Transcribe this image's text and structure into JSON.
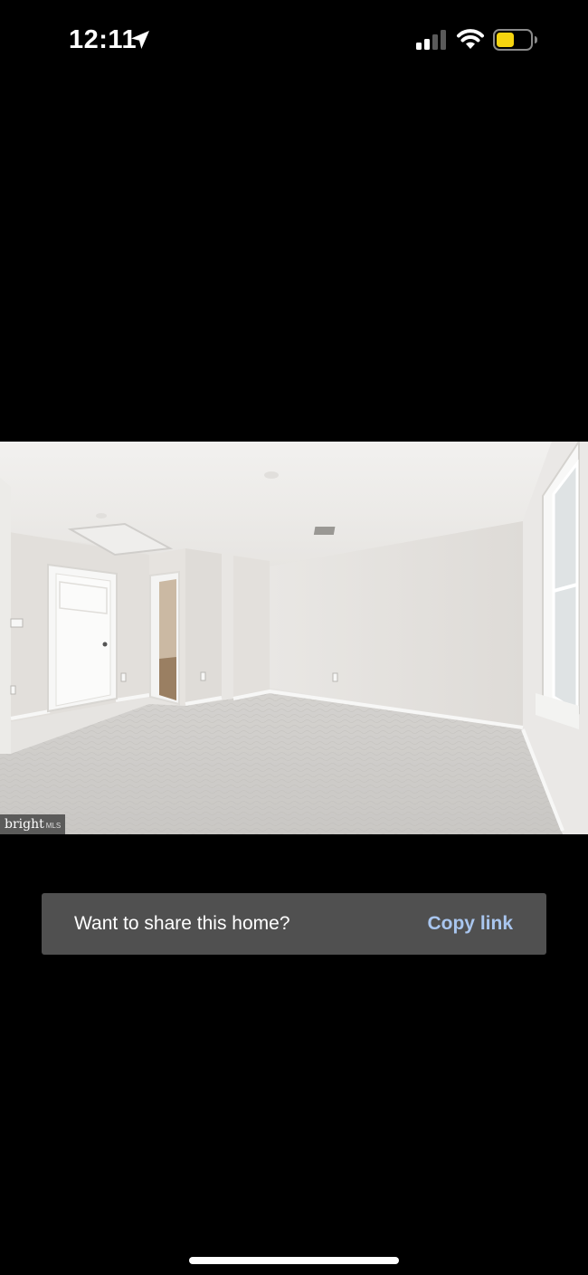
{
  "status_bar": {
    "time": "12:11",
    "location_icon": "location-arrow-icon",
    "signal_icon": "cellular-signal-icon",
    "wifi_icon": "wifi-icon",
    "battery_icon": "battery-icon",
    "battery_color": "#f5d40f"
  },
  "photo": {
    "watermark_brand": "bright",
    "watermark_suffix": "MLS"
  },
  "share_banner": {
    "message": "Want to share this home?",
    "action_label": "Copy link",
    "background": "#505050",
    "action_color": "#a9c6ef"
  }
}
